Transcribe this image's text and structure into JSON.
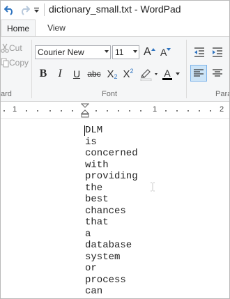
{
  "window": {
    "title": "dictionary_small.txt - WordPad"
  },
  "quick_access": {
    "undo_icon": "undo-icon",
    "redo_icon": "redo-icon",
    "customize_icon": "chevron-down-icon"
  },
  "tabs": [
    {
      "label": "Home",
      "selected": true
    },
    {
      "label": "View",
      "selected": false
    }
  ],
  "ribbon": {
    "clipboard": {
      "cut_label": "Cut",
      "copy_label": "Copy",
      "group_label": "ard"
    },
    "font": {
      "group_label": "Font",
      "font_name": "Courier New",
      "font_size": "11",
      "bold": "B",
      "italic": "I",
      "underline": "U",
      "strikethrough": "abc",
      "subscript_base": "X",
      "subscript_mark": "2",
      "superscript_base": "X",
      "superscript_mark": "2",
      "grow": "A",
      "shrink": "A",
      "font_color_letter": "A",
      "highlight_color": "#f5f6f7",
      "font_color": "#000000"
    },
    "paragraph": {
      "group_label": "Para"
    }
  },
  "ruler": {
    "numbers": [
      "1",
      "1",
      "2"
    ]
  },
  "document": {
    "lines": [
      "DLM",
      "is",
      "concerned",
      "with",
      "providing",
      "the",
      "best",
      "chances",
      "that",
      "a",
      "database",
      "system",
      "or",
      "process",
      "can"
    ]
  },
  "colors": {
    "accent": "#1e6fbf",
    "ribbon_bg": "#f5f6f7",
    "selected_button": "#cce4f7"
  }
}
